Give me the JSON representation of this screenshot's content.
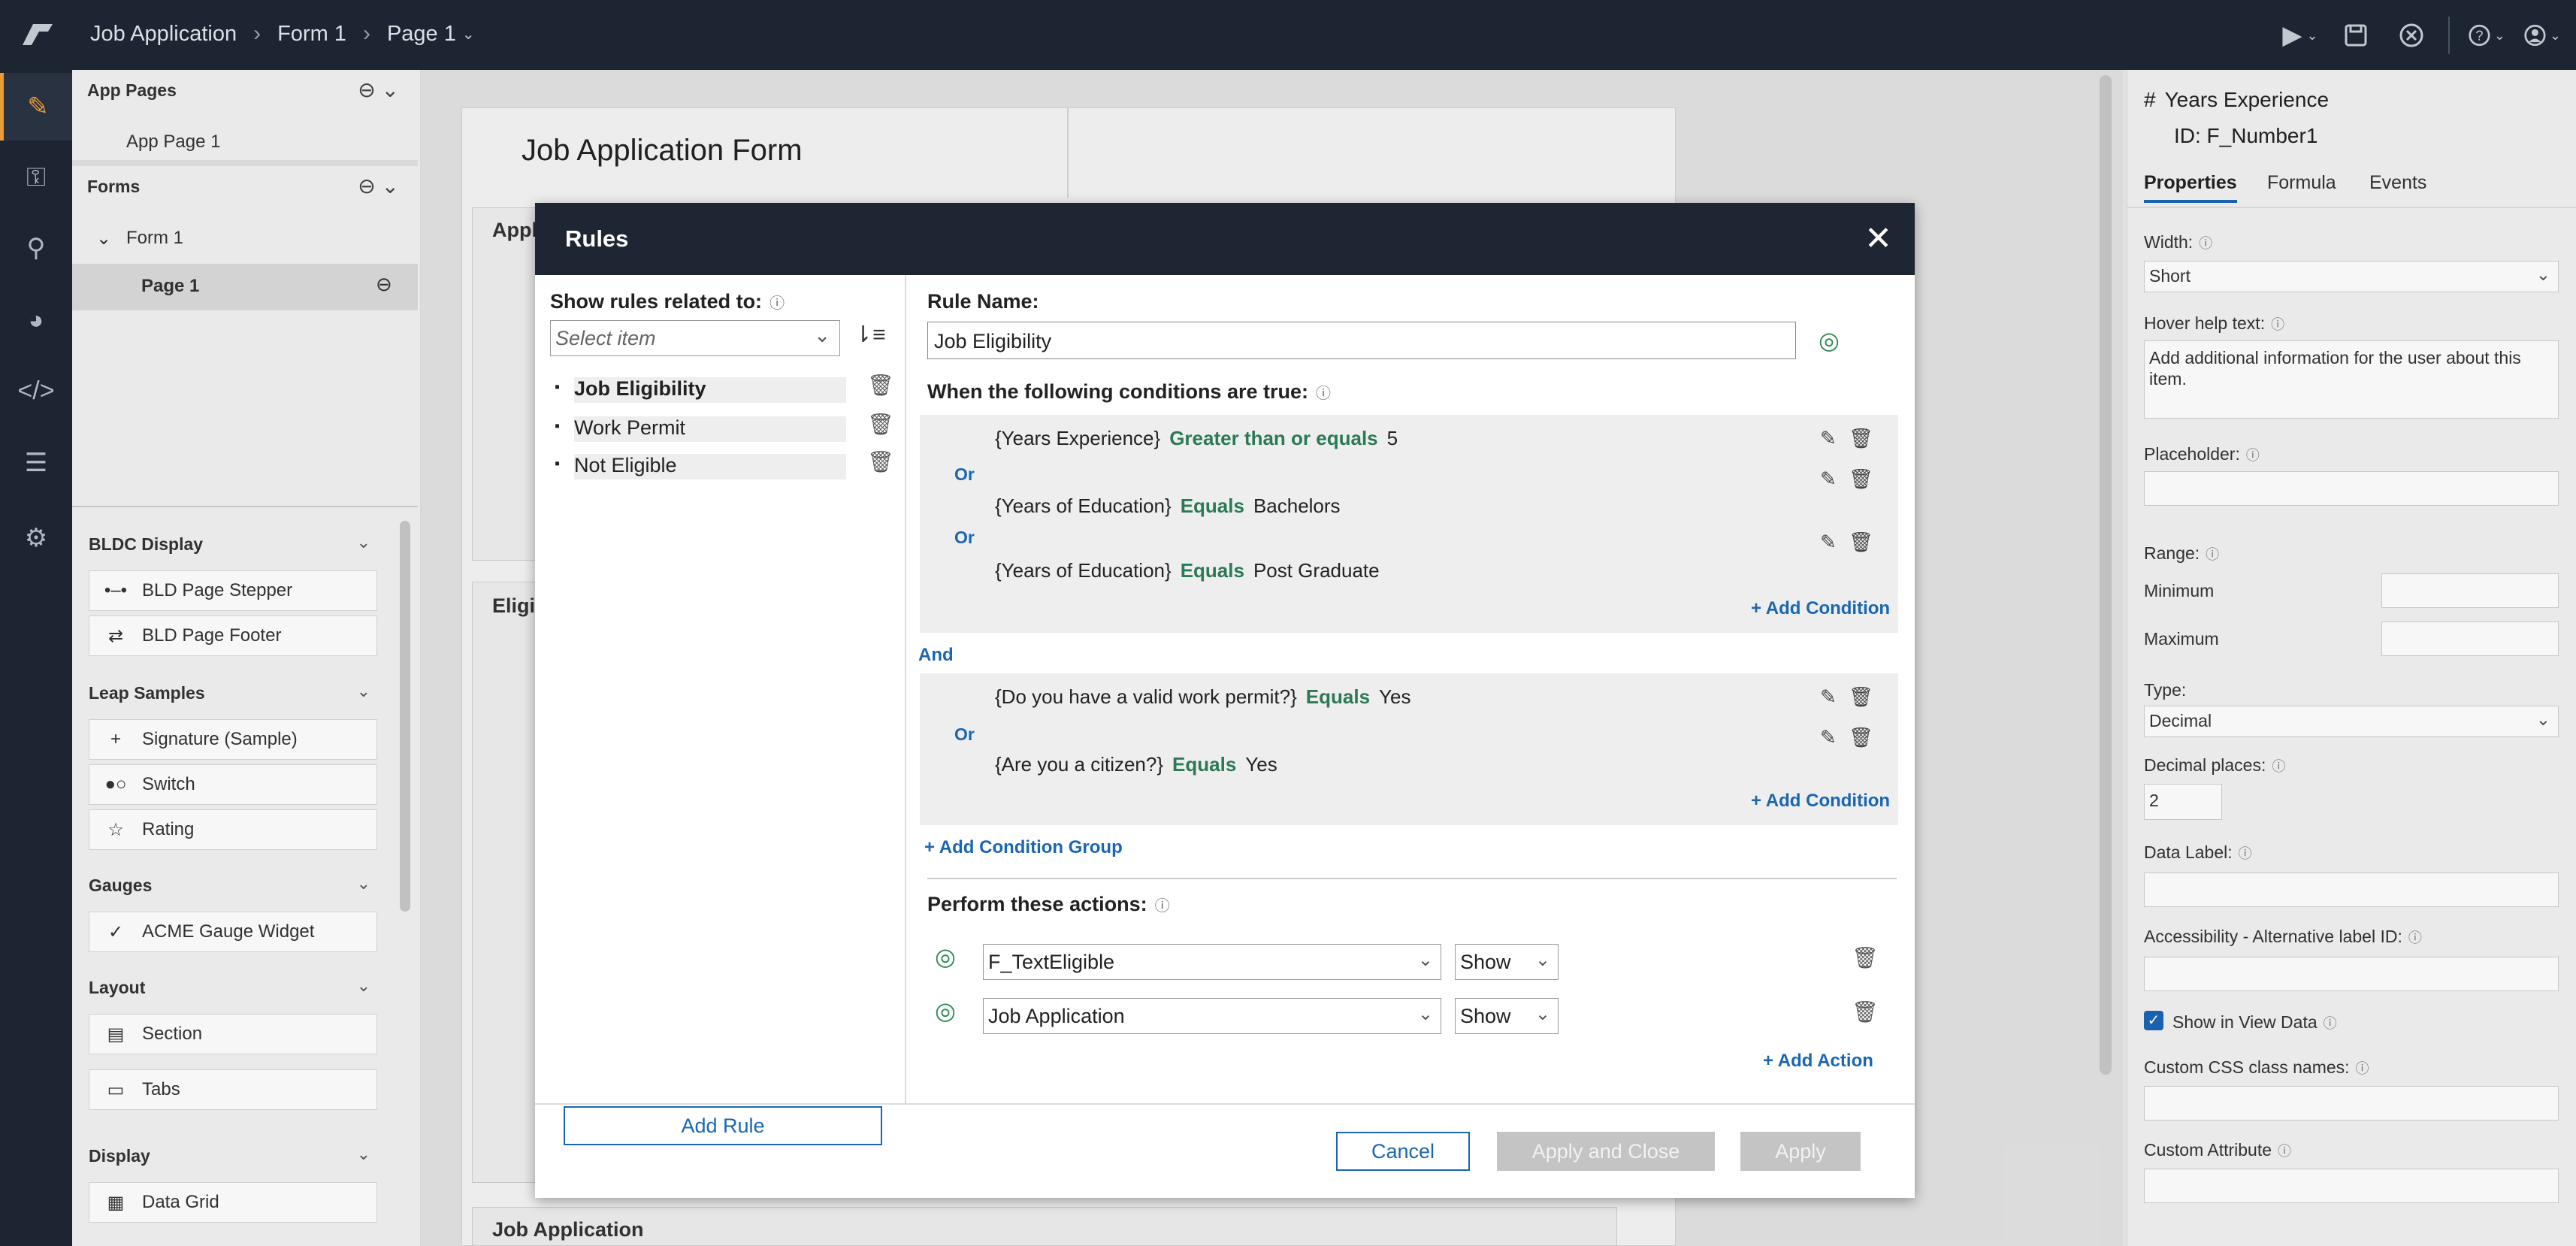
{
  "topbar": {
    "breadcrumb": [
      "Job Application",
      "Form 1",
      "Page 1"
    ],
    "icons": [
      "play-icon",
      "save-icon",
      "close-circle-icon",
      "help-icon",
      "user-icon"
    ]
  },
  "rail": {
    "icons": [
      "pencil-ruler-icon",
      "key-icon",
      "hierarchy-icon",
      "palette-icon",
      "code-icon",
      "list-icon",
      "gear-icon"
    ]
  },
  "left_panel": {
    "app_pages_title": "App Pages",
    "app_pages": [
      "App Page 1"
    ],
    "forms_title": "Forms",
    "form_name": "Form 1",
    "page_name": "Page 1",
    "sections": [
      {
        "title": "BLDC Display",
        "items": [
          {
            "label": "BLD Page Stepper",
            "icon": "stepper-icon"
          },
          {
            "label": "BLD Page Footer",
            "icon": "swap-icon"
          }
        ]
      },
      {
        "title": "Leap Samples",
        "items": [
          {
            "label": "Signature (Sample)",
            "icon": "plus-icon"
          },
          {
            "label": "Switch",
            "icon": "toggle-icon"
          },
          {
            "label": "Rating",
            "icon": "star-icon"
          }
        ]
      },
      {
        "title": "Gauges",
        "items": [
          {
            "label": "ACME Gauge Widget",
            "icon": "check-icon"
          }
        ]
      },
      {
        "title": "Layout",
        "items": [
          {
            "label": "Section",
            "icon": "section-icon"
          },
          {
            "label": "Tabs",
            "icon": "folder-icon"
          }
        ]
      },
      {
        "title": "Display",
        "items": [
          {
            "label": "Data Grid",
            "icon": "grid-icon"
          }
        ]
      }
    ]
  },
  "canvas": {
    "form_title": "Job Application Form",
    "section_partial_1": "Appl",
    "section_partial_2": "Eligi",
    "footer_section": "Job Application"
  },
  "right_panel": {
    "field_title": "Years Experience",
    "field_id": "ID:  F_Number1",
    "tabs": [
      "Properties",
      "Formula",
      "Events"
    ],
    "width_label": "Width:",
    "width_value": "Short",
    "hover_label": "Hover help text:",
    "hover_value": "Add additional information for the user about this item.",
    "placeholder_label": "Placeholder:",
    "range_label": "Range:",
    "minimum_label": "Minimum",
    "maximum_label": "Maximum",
    "type_label": "Type:",
    "type_value": "Decimal",
    "decimal_label": "Decimal places:",
    "decimal_value": "2",
    "data_label_label": "Data Label:",
    "accessibility_label": "Accessibility - Alternative label ID:",
    "show_view_data_label": "Show in View Data",
    "css_label": "Custom CSS class names:",
    "custom_attr_label": "Custom Attribute"
  },
  "modal": {
    "title": "Rules",
    "show_rules_label": "Show rules related to:",
    "select_placeholder": "Select item",
    "rules": [
      "Job Eligibility",
      "Work Permit",
      "Not Eligible"
    ],
    "add_rule_label": "Add Rule",
    "rule_name_label": "Rule Name:",
    "rule_name_value": "Job Eligibility",
    "conditions_label": "When the following conditions are true:",
    "or_label": "Or",
    "and_label": "And",
    "group1": [
      {
        "field": "{Years Experience}",
        "op": "Greater than or equals",
        "value": "5"
      },
      {
        "field": "{Years of Education}",
        "op": "Equals",
        "value": "Bachelors"
      },
      {
        "field": "{Years of Education}",
        "op": "Equals",
        "value": "Post Graduate"
      }
    ],
    "group2": [
      {
        "field": "{Do you have a valid work permit?}",
        "op": "Equals",
        "value": "Yes"
      },
      {
        "field": "{Are you a citizen?}",
        "op": "Equals",
        "value": "Yes"
      }
    ],
    "add_condition_label": "+ Add Condition",
    "add_condition_group_label": "+ Add Condition Group",
    "actions_label": "Perform these actions:",
    "actions": [
      {
        "target": "F_TextEligible",
        "action": "Show"
      },
      {
        "target": "Job Application",
        "action": "Show"
      }
    ],
    "add_action_label": "+ Add Action",
    "cancel_label": "Cancel",
    "apply_close_label": "Apply and Close",
    "apply_label": "Apply"
  },
  "colors": {
    "header": "#1e2634",
    "accent": "#1a66b3",
    "operator": "#2c7a55",
    "active_rail": "#f2a23a"
  }
}
